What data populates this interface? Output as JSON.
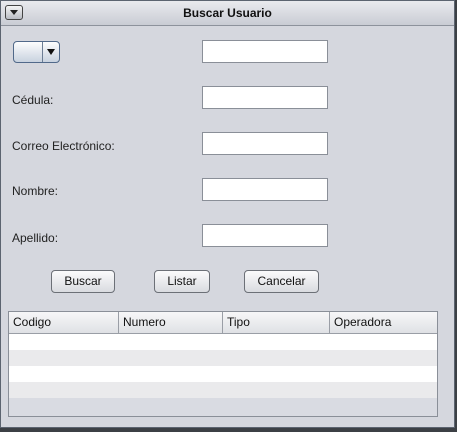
{
  "window": {
    "title": "Buscar Usuario"
  },
  "combo": {
    "selected": ""
  },
  "fields": [
    {
      "label": "",
      "value": ""
    },
    {
      "label": "Cédula:",
      "value": ""
    },
    {
      "label": "Correo Electrónico:",
      "value": ""
    },
    {
      "label": "Nombre:",
      "value": ""
    },
    {
      "label": "Apellido:",
      "value": ""
    }
  ],
  "buttons": {
    "buscar": "Buscar",
    "listar": "Listar",
    "cancelar": "Cancelar"
  },
  "table": {
    "columns": [
      "Codigo",
      "Numero",
      "Tipo",
      "Operadora"
    ],
    "rows": []
  },
  "colors": {
    "window_bg": "#d5d7de",
    "row_even": "#ffffff",
    "row_odd": "#eaeaec"
  }
}
